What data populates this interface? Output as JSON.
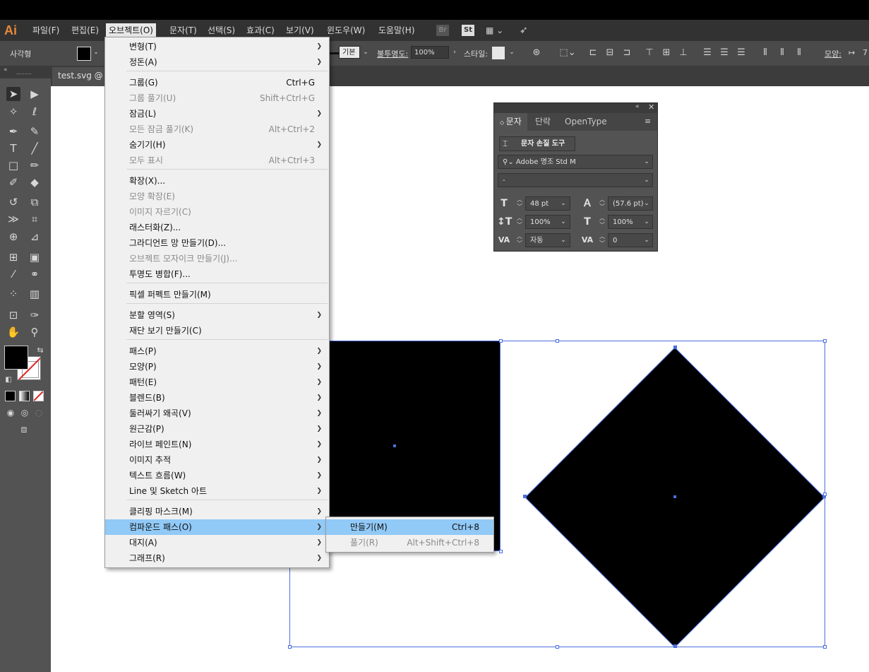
{
  "app": {
    "logo": "Ai",
    "menubar": [
      "파일(F)",
      "편집(E)",
      "오브젝트(O)",
      "문자(T)",
      "선택(S)",
      "효과(C)",
      "보기(V)",
      "윈도우(W)",
      "도움말(H)"
    ],
    "bridge_label": "Br",
    "stock_label": "St"
  },
  "control_bar": {
    "object_type": "사각형",
    "stroke_style": "기본",
    "opacity_label": "불투명도:",
    "opacity_value": "100%",
    "style_label": "스타일:",
    "shape_label": "모양:",
    "shape_value": "7"
  },
  "document": {
    "tab_label": "test.svg  @  "
  },
  "object_menu": {
    "items": [
      {
        "label": "변형(T)",
        "shortcut": "",
        "submenu": true,
        "disabled": false
      },
      {
        "label": "정돈(A)",
        "shortcut": "",
        "submenu": true,
        "disabled": false
      },
      {
        "label": "그룹(G)",
        "shortcut": "Ctrl+G",
        "submenu": false,
        "disabled": false
      },
      {
        "label": "그룹 풀기(U)",
        "shortcut": "Shift+Ctrl+G",
        "submenu": false,
        "disabled": true
      },
      {
        "label": "잠금(L)",
        "shortcut": "",
        "submenu": true,
        "disabled": false
      },
      {
        "label": "모든 잠금 풀기(K)",
        "shortcut": "Alt+Ctrl+2",
        "submenu": false,
        "disabled": true
      },
      {
        "label": "숨기기(H)",
        "shortcut": "",
        "submenu": true,
        "disabled": false
      },
      {
        "label": "모두 표시",
        "shortcut": "Alt+Ctrl+3",
        "submenu": false,
        "disabled": true
      },
      {
        "label": "확장(X)...",
        "shortcut": "",
        "submenu": false,
        "disabled": false
      },
      {
        "label": "모양 확장(E)",
        "shortcut": "",
        "submenu": false,
        "disabled": true
      },
      {
        "label": "이미지 자르기(C)",
        "shortcut": "",
        "submenu": false,
        "disabled": true
      },
      {
        "label": "래스터화(Z)...",
        "shortcut": "",
        "submenu": false,
        "disabled": false
      },
      {
        "label": "그라디언트 망 만들기(D)...",
        "shortcut": "",
        "submenu": false,
        "disabled": false
      },
      {
        "label": "오브젝트 모자이크 만들기(J)...",
        "shortcut": "",
        "submenu": false,
        "disabled": true
      },
      {
        "label": "투명도 병합(F)...",
        "shortcut": "",
        "submenu": false,
        "disabled": false
      },
      {
        "label": "픽셀 퍼펙트 만들기(M)",
        "shortcut": "",
        "submenu": false,
        "disabled": false
      },
      {
        "label": "분할 영역(S)",
        "shortcut": "",
        "submenu": true,
        "disabled": false
      },
      {
        "label": "재단 보기 만들기(C)",
        "shortcut": "",
        "submenu": false,
        "disabled": false
      },
      {
        "label": "패스(P)",
        "shortcut": "",
        "submenu": true,
        "disabled": false
      },
      {
        "label": "모양(P)",
        "shortcut": "",
        "submenu": true,
        "disabled": false
      },
      {
        "label": "패턴(E)",
        "shortcut": "",
        "submenu": true,
        "disabled": false
      },
      {
        "label": "블렌드(B)",
        "shortcut": "",
        "submenu": true,
        "disabled": false
      },
      {
        "label": "둘러싸기 왜곡(V)",
        "shortcut": "",
        "submenu": true,
        "disabled": false
      },
      {
        "label": "원근감(P)",
        "shortcut": "",
        "submenu": true,
        "disabled": false
      },
      {
        "label": "라이브 페인트(N)",
        "shortcut": "",
        "submenu": true,
        "disabled": false
      },
      {
        "label": "이미지 추적",
        "shortcut": "",
        "submenu": true,
        "disabled": false
      },
      {
        "label": "텍스트 흐름(W)",
        "shortcut": "",
        "submenu": true,
        "disabled": false
      },
      {
        "label": "Line 및 Sketch 아트",
        "shortcut": "",
        "submenu": true,
        "disabled": false
      },
      {
        "label": "클리핑 마스크(M)",
        "shortcut": "",
        "submenu": true,
        "disabled": false
      },
      {
        "label": "컴파운드 패스(O)",
        "shortcut": "",
        "submenu": true,
        "disabled": false,
        "highlighted": true
      },
      {
        "label": "대지(A)",
        "shortcut": "",
        "submenu": true,
        "disabled": false
      },
      {
        "label": "그래프(R)",
        "shortcut": "",
        "submenu": true,
        "disabled": false
      }
    ]
  },
  "compound_submenu": {
    "items": [
      {
        "label": "만들기(M)",
        "shortcut": "Ctrl+8",
        "disabled": false,
        "highlighted": true
      },
      {
        "label": "풀기(R)",
        "shortcut": "Alt+Shift+Ctrl+8",
        "disabled": true
      }
    ]
  },
  "character_panel": {
    "tabs": [
      "문자",
      "단락",
      "OpenType"
    ],
    "touch_tool_label": "문자 손질 도구",
    "font_family": "Adobe 명조 Std M",
    "font_style": "-",
    "font_size": "48 pt",
    "leading": "(57.6 pt)",
    "vertical_scale": "100%",
    "horizontal_scale": "100%",
    "kerning": "자동",
    "tracking": "0"
  },
  "colors": {
    "accent_highlight": "#91c9f7",
    "selection_blue": "#4a6ee0",
    "logo_orange": "#e8893a"
  }
}
